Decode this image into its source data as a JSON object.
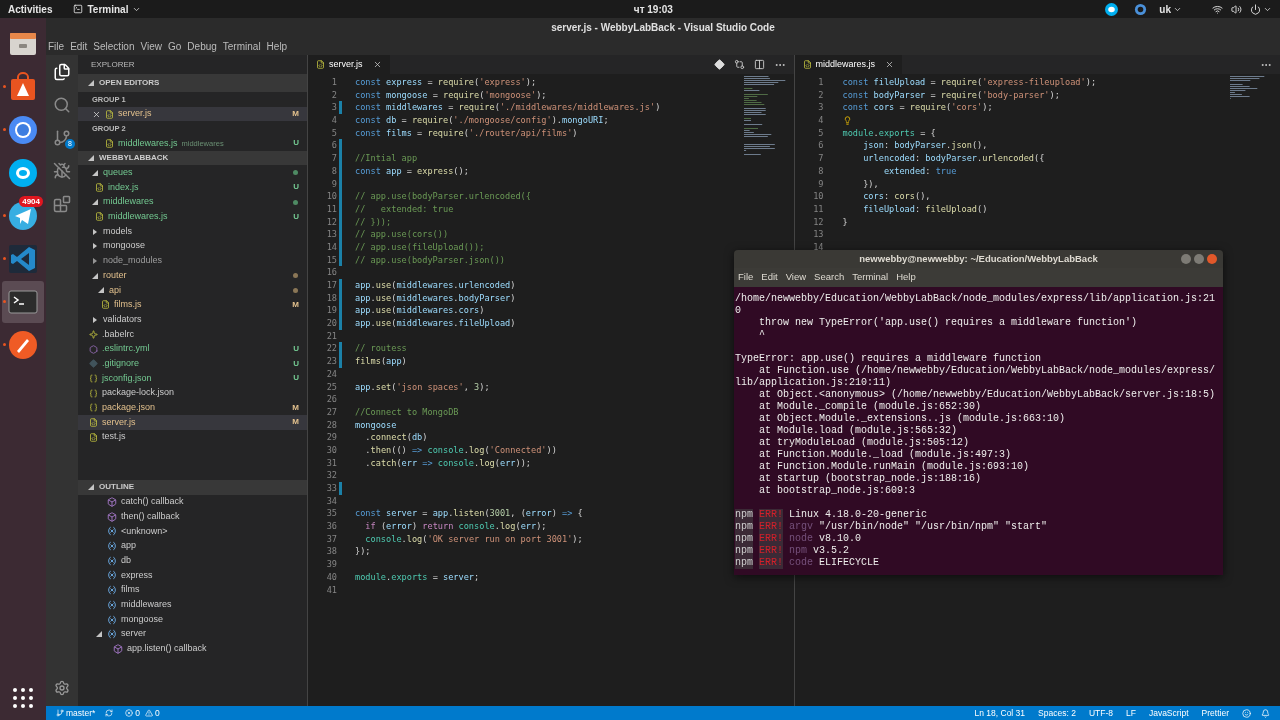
{
  "top_bar": {
    "activities": "Activities",
    "app_menu": "Terminal",
    "clock": "чт 19:03",
    "keyboard": "uk"
  },
  "dock": {
    "items": [
      {
        "kind": "files",
        "running": false,
        "selected": false
      },
      {
        "kind": "software",
        "running": true,
        "selected": false
      },
      {
        "kind": "browser",
        "running": true,
        "selected": false
      },
      {
        "kind": "skype",
        "running": false,
        "selected": false
      },
      {
        "kind": "telegram",
        "running": true,
        "selected": false,
        "badge": "4904"
      },
      {
        "kind": "vscode",
        "running": true,
        "selected": false
      },
      {
        "kind": "terminal",
        "running": true,
        "selected": true
      },
      {
        "kind": "postman",
        "running": true,
        "selected": false
      }
    ]
  },
  "vscode": {
    "title": "server.js - WebbyLabBack - Visual Studio Code",
    "menu": [
      "File",
      "Edit",
      "Selection",
      "View",
      "Go",
      "Debug",
      "Terminal",
      "Help"
    ],
    "activity_bar": [
      {
        "kind": "files",
        "selected": true
      },
      {
        "kind": "search",
        "selected": false
      },
      {
        "kind": "scm",
        "selected": false,
        "badge": "8"
      },
      {
        "kind": "debug",
        "selected": false
      },
      {
        "kind": "extensions",
        "selected": false
      }
    ],
    "sidebar": {
      "title": "EXPLORER",
      "open_editors": {
        "title": "OPEN EDITORS",
        "expanded": true,
        "groups": [
          {
            "title": "GROUP 1",
            "files": [
              {
                "name": "server.js",
                "kind": "js",
                "modified": true,
                "untracked": false,
                "badge": "M",
                "selected": true
              }
            ]
          },
          {
            "title": "GROUP 2",
            "files": [
              {
                "name": "middlewares.js",
                "description": "middlewares",
                "kind": "js",
                "modified": false,
                "untracked": true,
                "badge": "U",
                "selected": false
              }
            ]
          }
        ]
      },
      "project": {
        "title": "WEBBYLABBACK",
        "expanded": true,
        "tree": [
          {
            "kind": "folder",
            "name": "queues",
            "modified": false,
            "untracked": true,
            "ignored": false,
            "expanded": true,
            "selected": false,
            "children": [
              {
                "kind": "js",
                "name": "index.js",
                "modified": false,
                "untracked": true,
                "ignored": false,
                "badge": "U",
                "selected": false
              }
            ]
          },
          {
            "kind": "folder",
            "name": "middlewares",
            "modified": false,
            "untracked": true,
            "ignored": false,
            "expanded": true,
            "selected": false,
            "children": [
              {
                "kind": "js",
                "name": "middlewares.js",
                "modified": false,
                "untracked": true,
                "ignored": false,
                "badge": "U",
                "selected": false
              }
            ]
          },
          {
            "kind": "folder",
            "name": "models",
            "modified": false,
            "untracked": false,
            "ignored": false,
            "expanded": false,
            "selected": false
          },
          {
            "kind": "folder",
            "name": "mongoose",
            "modified": false,
            "untracked": false,
            "ignored": false,
            "expanded": false,
            "selected": false
          },
          {
            "kind": "folder",
            "name": "node_modules",
            "modified": false,
            "untracked": false,
            "ignored": true,
            "expanded": false,
            "selected": false
          },
          {
            "kind": "folder",
            "name": "router",
            "modified": true,
            "untracked": false,
            "ignored": false,
            "expanded": true,
            "selected": false,
            "children": [
              {
                "kind": "folder",
                "name": "api",
                "modified": true,
                "untracked": false,
                "ignored": false,
                "expanded": true,
                "selected": false,
                "children": [
                  {
                    "kind": "js",
                    "name": "films.js",
                    "modified": true,
                    "untracked": false,
                    "ignored": false,
                    "badge": "M",
                    "selected": false
                  }
                ]
              }
            ]
          },
          {
            "kind": "folder",
            "name": "validators",
            "modified": false,
            "untracked": false,
            "ignored": false,
            "expanded": false,
            "selected": false
          },
          {
            "kind": "babel",
            "name": ".babelrc",
            "modified": false,
            "untracked": false,
            "ignored": false,
            "selected": false
          },
          {
            "kind": "eslint",
            "name": ".eslintrc.yml",
            "modified": false,
            "untracked": true,
            "ignored": false,
            "badge": "U",
            "selected": false
          },
          {
            "kind": "git",
            "name": ".gitignore",
            "modified": false,
            "untracked": true,
            "ignored": false,
            "badge": "U",
            "selected": false
          },
          {
            "kind": "json",
            "name": "jsconfig.json",
            "modified": false,
            "untracked": true,
            "ignored": false,
            "badge": "U",
            "selected": false
          },
          {
            "kind": "json",
            "name": "package-lock.json",
            "modified": false,
            "untracked": false,
            "ignored": false,
            "selected": false
          },
          {
            "kind": "json",
            "name": "package.json",
            "modified": true,
            "untracked": false,
            "ignored": false,
            "badge": "M",
            "selected": false
          },
          {
            "kind": "js",
            "name": "server.js",
            "modified": true,
            "untracked": false,
            "ignored": false,
            "badge": "M",
            "selected": true
          },
          {
            "kind": "js",
            "name": "test.js",
            "modified": false,
            "untracked": false,
            "ignored": false,
            "selected": false
          }
        ]
      },
      "outline": {
        "title": "OUTLINE",
        "expanded": true,
        "items": [
          {
            "kind": "callback",
            "name": "catch() callback"
          },
          {
            "kind": "callback",
            "name": "then() callback"
          },
          {
            "kind": "variable",
            "name": "<unknown>"
          },
          {
            "kind": "variable",
            "name": "app"
          },
          {
            "kind": "variable",
            "name": "db"
          },
          {
            "kind": "variable",
            "name": "express"
          },
          {
            "kind": "variable",
            "name": "films"
          },
          {
            "kind": "variable",
            "name": "middlewares"
          },
          {
            "kind": "variable",
            "name": "mongoose"
          },
          {
            "kind": "variable",
            "name": "server",
            "expanded": true,
            "children": [
              {
                "kind": "callback",
                "name": "app.listen() callback"
              }
            ]
          }
        ]
      }
    },
    "editors": [
      {
        "tab": {
          "label": "server.js",
          "selected": true
        },
        "lines": [
          {
            "number": "1",
            "changed": false,
            "tokens": [
              {
                "kind": "kw",
                "text": "const "
              },
              {
                "kind": "var",
                "text": "express"
              },
              {
                "kind": "p",
                "text": " = "
              },
              {
                "kind": "fn",
                "text": "require"
              },
              {
                "kind": "p",
                "text": "("
              },
              {
                "kind": "str",
                "text": "'express'"
              },
              {
                "kind": "p",
                "text": ");"
              }
            ]
          },
          {
            "number": "2",
            "changed": false,
            "tokens": [
              {
                "kind": "kw",
                "text": "const "
              },
              {
                "kind": "var",
                "text": "mongoose"
              },
              {
                "kind": "p",
                "text": " = "
              },
              {
                "kind": "fn",
                "text": "require"
              },
              {
                "kind": "p",
                "text": "("
              },
              {
                "kind": "str",
                "text": "'mongoose'"
              },
              {
                "kind": "p",
                "text": ");"
              }
            ]
          },
          {
            "number": "3",
            "changed": true,
            "tokens": [
              {
                "kind": "kw",
                "text": "const "
              },
              {
                "kind": "var",
                "text": "middlewares"
              },
              {
                "kind": "p",
                "text": " = "
              },
              {
                "kind": "fn",
                "text": "require"
              },
              {
                "kind": "p",
                "text": "("
              },
              {
                "kind": "str",
                "text": "'./middlewares/middlewares.js'"
              },
              {
                "kind": "p",
                "text": ")"
              }
            ]
          },
          {
            "number": "4",
            "changed": false,
            "tokens": [
              {
                "kind": "kw",
                "text": "const "
              },
              {
                "kind": "var",
                "text": "db"
              },
              {
                "kind": "p",
                "text": " = "
              },
              {
                "kind": "fn",
                "text": "require"
              },
              {
                "kind": "p",
                "text": "("
              },
              {
                "kind": "str",
                "text": "'./mongoose/config'"
              },
              {
                "kind": "p",
                "text": ")."
              },
              {
                "kind": "var",
                "text": "mongoURI"
              },
              {
                "kind": "p",
                "text": ";"
              }
            ]
          },
          {
            "number": "5",
            "changed": false,
            "tokens": [
              {
                "kind": "kw",
                "text": "const "
              },
              {
                "kind": "var",
                "text": "films"
              },
              {
                "kind": "p",
                "text": " = "
              },
              {
                "kind": "fn",
                "text": "require"
              },
              {
                "kind": "p",
                "text": "("
              },
              {
                "kind": "str",
                "text": "'./router/api/films'"
              },
              {
                "kind": "p",
                "text": ")"
              }
            ]
          },
          {
            "number": "6",
            "changed": true
          },
          {
            "number": "7",
            "changed": true,
            "tokens": [
              {
                "kind": "com",
                "text": "//Intial app"
              }
            ]
          },
          {
            "number": "8",
            "changed": true,
            "tokens": [
              {
                "kind": "kw",
                "text": "const "
              },
              {
                "kind": "var",
                "text": "app"
              },
              {
                "kind": "p",
                "text": " = "
              },
              {
                "kind": "fn",
                "text": "express"
              },
              {
                "kind": "p",
                "text": "();"
              }
            ]
          },
          {
            "number": "9",
            "changed": true
          },
          {
            "number": "10",
            "changed": true,
            "tokens": [
              {
                "kind": "com",
                "text": "// app.use(bodyParser.urlencoded({"
              }
            ]
          },
          {
            "number": "11",
            "changed": true,
            "tokens": [
              {
                "kind": "com",
                "text": "//   extended: true"
              }
            ]
          },
          {
            "number": "12",
            "changed": true,
            "tokens": [
              {
                "kind": "com",
                "text": "// }));"
              }
            ]
          },
          {
            "number": "13",
            "changed": true,
            "tokens": [
              {
                "kind": "com",
                "text": "// app.use(cors())"
              }
            ]
          },
          {
            "number": "14",
            "changed": true,
            "tokens": [
              {
                "kind": "com",
                "text": "// app.use(fileUpload());"
              }
            ]
          },
          {
            "number": "15",
            "changed": true,
            "tokens": [
              {
                "kind": "com",
                "text": "// app.use(bodyParser.json())"
              }
            ]
          },
          {
            "number": "16",
            "changed": false
          },
          {
            "number": "17",
            "changed": true,
            "tokens": [
              {
                "kind": "var",
                "text": "app"
              },
              {
                "kind": "p",
                "text": "."
              },
              {
                "kind": "fn",
                "text": "use"
              },
              {
                "kind": "p",
                "text": "("
              },
              {
                "kind": "var",
                "text": "middlewares"
              },
              {
                "kind": "p",
                "text": "."
              },
              {
                "kind": "var",
                "text": "urlencoded"
              },
              {
                "kind": "p",
                "text": ")"
              }
            ]
          },
          {
            "number": "18",
            "changed": true,
            "tokens": [
              {
                "kind": "var",
                "text": "app"
              },
              {
                "kind": "p",
                "text": "."
              },
              {
                "kind": "fn",
                "text": "use"
              },
              {
                "kind": "p",
                "text": "("
              },
              {
                "kind": "var",
                "text": "middlewares"
              },
              {
                "kind": "p",
                "text": "."
              },
              {
                "kind": "var",
                "text": "bodyParser"
              },
              {
                "kind": "p",
                "text": ")"
              }
            ]
          },
          {
            "number": "19",
            "changed": true,
            "tokens": [
              {
                "kind": "var",
                "text": "app"
              },
              {
                "kind": "p",
                "text": "."
              },
              {
                "kind": "fn",
                "text": "use"
              },
              {
                "kind": "p",
                "text": "("
              },
              {
                "kind": "var",
                "text": "middlewares"
              },
              {
                "kind": "p",
                "text": "."
              },
              {
                "kind": "var",
                "text": "cors"
              },
              {
                "kind": "p",
                "text": ")"
              }
            ]
          },
          {
            "number": "20",
            "changed": true,
            "tokens": [
              {
                "kind": "var",
                "text": "app"
              },
              {
                "kind": "p",
                "text": "."
              },
              {
                "kind": "fn",
                "text": "use"
              },
              {
                "kind": "p",
                "text": "("
              },
              {
                "kind": "var",
                "text": "middlewares"
              },
              {
                "kind": "p",
                "text": "."
              },
              {
                "kind": "var",
                "text": "fileUpload"
              },
              {
                "kind": "p",
                "text": ")"
              }
            ]
          },
          {
            "number": "21",
            "changed": false
          },
          {
            "number": "22",
            "changed": true,
            "tokens": [
              {
                "kind": "com",
                "text": "// routess"
              }
            ]
          },
          {
            "number": "23",
            "changed": true,
            "tokens": [
              {
                "kind": "fn",
                "text": "films"
              },
              {
                "kind": "p",
                "text": "("
              },
              {
                "kind": "var",
                "text": "app"
              },
              {
                "kind": "p",
                "text": ")"
              }
            ]
          },
          {
            "number": "24",
            "changed": false
          },
          {
            "number": "25",
            "changed": false,
            "tokens": [
              {
                "kind": "var",
                "text": "app"
              },
              {
                "kind": "p",
                "text": "."
              },
              {
                "kind": "fn",
                "text": "set"
              },
              {
                "kind": "p",
                "text": "("
              },
              {
                "kind": "str",
                "text": "'json spaces'"
              },
              {
                "kind": "p",
                "text": ", "
              },
              {
                "kind": "num",
                "text": "3"
              },
              {
                "kind": "p",
                "text": ");"
              }
            ]
          },
          {
            "number": "26",
            "changed": false
          },
          {
            "number": "27",
            "changed": false,
            "tokens": [
              {
                "kind": "com",
                "text": "//Connect to MongoDB"
              }
            ]
          },
          {
            "number": "28",
            "changed": false,
            "tokens": [
              {
                "kind": "var",
                "text": "mongoose"
              }
            ]
          },
          {
            "number": "29",
            "changed": false,
            "tokens": [
              {
                "kind": "p",
                "text": "  ."
              },
              {
                "kind": "fn",
                "text": "connect"
              },
              {
                "kind": "p",
                "text": "("
              },
              {
                "kind": "var",
                "text": "db"
              },
              {
                "kind": "p",
                "text": ")"
              }
            ]
          },
          {
            "number": "30",
            "changed": false,
            "tokens": [
              {
                "kind": "p",
                "text": "  ."
              },
              {
                "kind": "fn",
                "text": "then"
              },
              {
                "kind": "p",
                "text": "(() "
              },
              {
                "kind": "kw",
                "text": "=> "
              },
              {
                "kind": "cls",
                "text": "console"
              },
              {
                "kind": "p",
                "text": "."
              },
              {
                "kind": "fn",
                "text": "log"
              },
              {
                "kind": "p",
                "text": "("
              },
              {
                "kind": "str",
                "text": "'Connected'"
              },
              {
                "kind": "p",
                "text": "))"
              }
            ]
          },
          {
            "number": "31",
            "changed": false,
            "tokens": [
              {
                "kind": "p",
                "text": "  ."
              },
              {
                "kind": "fn",
                "text": "catch"
              },
              {
                "kind": "p",
                "text": "("
              },
              {
                "kind": "var",
                "text": "err "
              },
              {
                "kind": "kw",
                "text": "=> "
              },
              {
                "kind": "cls",
                "text": "console"
              },
              {
                "kind": "p",
                "text": "."
              },
              {
                "kind": "fn",
                "text": "log"
              },
              {
                "kind": "p",
                "text": "("
              },
              {
                "kind": "var",
                "text": "err"
              },
              {
                "kind": "p",
                "text": "));"
              }
            ]
          },
          {
            "number": "32",
            "changed": false
          },
          {
            "number": "33",
            "changed": true
          },
          {
            "number": "34",
            "changed": false
          },
          {
            "number": "35",
            "changed": false,
            "tokens": [
              {
                "kind": "kw",
                "text": "const "
              },
              {
                "kind": "var",
                "text": "server"
              },
              {
                "kind": "p",
                "text": " = "
              },
              {
                "kind": "var",
                "text": "app"
              },
              {
                "kind": "p",
                "text": "."
              },
              {
                "kind": "fn",
                "text": "listen"
              },
              {
                "kind": "p",
                "text": "("
              },
              {
                "kind": "num",
                "text": "3001"
              },
              {
                "kind": "p",
                "text": ", ("
              },
              {
                "kind": "var",
                "text": "error"
              },
              {
                "kind": "p",
                "text": ") "
              },
              {
                "kind": "kw",
                "text": "=>"
              },
              {
                "kind": "p",
                "text": " {"
              }
            ]
          },
          {
            "number": "36",
            "changed": false,
            "tokens": [
              {
                "kind": "ctl",
                "text": "  if"
              },
              {
                "kind": "p",
                "text": " ("
              },
              {
                "kind": "var",
                "text": "error"
              },
              {
                "kind": "p",
                "text": ") "
              },
              {
                "kind": "ctl",
                "text": "return "
              },
              {
                "kind": "cls",
                "text": "console"
              },
              {
                "kind": "p",
                "text": "."
              },
              {
                "kind": "fn",
                "text": "log"
              },
              {
                "kind": "p",
                "text": "("
              },
              {
                "kind": "var",
                "text": "err"
              },
              {
                "kind": "p",
                "text": ");"
              }
            ]
          },
          {
            "number": "37",
            "changed": false,
            "tokens": [
              {
                "kind": "cls",
                "text": "  console"
              },
              {
                "kind": "p",
                "text": "."
              },
              {
                "kind": "fn",
                "text": "log"
              },
              {
                "kind": "p",
                "text": "("
              },
              {
                "kind": "str",
                "text": "'OK server run on port 3001'"
              },
              {
                "kind": "p",
                "text": ");"
              }
            ]
          },
          {
            "number": "38",
            "changed": false,
            "tokens": [
              {
                "kind": "p",
                "text": "});"
              }
            ]
          },
          {
            "number": "39",
            "changed": false
          },
          {
            "number": "40",
            "changed": false,
            "tokens": [
              {
                "kind": "cls",
                "text": "module"
              },
              {
                "kind": "p",
                "text": "."
              },
              {
                "kind": "cls",
                "text": "exports"
              },
              {
                "kind": "p",
                "text": " = "
              },
              {
                "kind": "var",
                "text": "server"
              },
              {
                "kind": "p",
                "text": ";"
              }
            ]
          },
          {
            "number": "41",
            "changed": false
          }
        ]
      },
      {
        "tab": {
          "label": "middlewares.js",
          "selected": true
        },
        "lines": [
          {
            "number": "1",
            "tokens": [
              {
                "kind": "kw",
                "text": "const "
              },
              {
                "kind": "var",
                "text": "fileUpload"
              },
              {
                "kind": "p",
                "text": " = "
              },
              {
                "kind": "fn",
                "text": "require"
              },
              {
                "kind": "p",
                "text": "("
              },
              {
                "kind": "str",
                "text": "'express-fileupload'"
              },
              {
                "kind": "p",
                "text": ");"
              }
            ]
          },
          {
            "number": "2",
            "tokens": [
              {
                "kind": "kw",
                "text": "const "
              },
              {
                "kind": "var",
                "text": "bodyParser"
              },
              {
                "kind": "p",
                "text": " = "
              },
              {
                "kind": "fn",
                "text": "require"
              },
              {
                "kind": "p",
                "text": "("
              },
              {
                "kind": "str",
                "text": "'body-parser'"
              },
              {
                "kind": "p",
                "text": ");"
              }
            ]
          },
          {
            "number": "3",
            "tokens": [
              {
                "kind": "kw",
                "text": "const "
              },
              {
                "kind": "var",
                "text": "cors"
              },
              {
                "kind": "p",
                "text": " = "
              },
              {
                "kind": "fn",
                "text": "require"
              },
              {
                "kind": "p",
                "text": "("
              },
              {
                "kind": "str",
                "text": "'cors'"
              },
              {
                "kind": "p",
                "text": ");"
              }
            ]
          },
          {
            "number": "4",
            "hint": true
          },
          {
            "number": "5",
            "tokens": [
              {
                "kind": "cls",
                "text": "module"
              },
              {
                "kind": "p",
                "text": "."
              },
              {
                "kind": "cls",
                "text": "exports"
              },
              {
                "kind": "p",
                "text": " = {"
              }
            ]
          },
          {
            "number": "6",
            "tokens": [
              {
                "kind": "var",
                "text": "    json"
              },
              {
                "kind": "p",
                "text": ": "
              },
              {
                "kind": "var",
                "text": "bodyParser"
              },
              {
                "kind": "p",
                "text": "."
              },
              {
                "kind": "fn",
                "text": "json"
              },
              {
                "kind": "p",
                "text": "(),"
              }
            ]
          },
          {
            "number": "7",
            "tokens": [
              {
                "kind": "var",
                "text": "    urlencoded"
              },
              {
                "kind": "p",
                "text": ": "
              },
              {
                "kind": "var",
                "text": "bodyParser"
              },
              {
                "kind": "p",
                "text": "."
              },
              {
                "kind": "fn",
                "text": "urlencoded"
              },
              {
                "kind": "p",
                "text": "({"
              }
            ]
          },
          {
            "number": "8",
            "tokens": [
              {
                "kind": "var",
                "text": "        extended"
              },
              {
                "kind": "p",
                "text": ": "
              },
              {
                "kind": "kw",
                "text": "true"
              }
            ]
          },
          {
            "number": "9",
            "tokens": [
              {
                "kind": "p",
                "text": "    }),"
              }
            ]
          },
          {
            "number": "10",
            "tokens": [
              {
                "kind": "var",
                "text": "    cors"
              },
              {
                "kind": "p",
                "text": ": "
              },
              {
                "kind": "fn",
                "text": "cors"
              },
              {
                "kind": "p",
                "text": "(),"
              }
            ]
          },
          {
            "number": "11",
            "tokens": [
              {
                "kind": "var",
                "text": "    fileUpload"
              },
              {
                "kind": "p",
                "text": ": "
              },
              {
                "kind": "fn",
                "text": "fileUpload"
              },
              {
                "kind": "p",
                "text": "()"
              }
            ]
          },
          {
            "number": "12",
            "tokens": [
              {
                "kind": "p",
                "text": "}"
              }
            ]
          },
          {
            "number": "13"
          },
          {
            "number": "14"
          }
        ]
      }
    ],
    "status_bar": {
      "branch": "master*",
      "errors": "0",
      "warnings": "0",
      "items": [
        "Ln 18, Col 31",
        "Spaces: 2",
        "UTF-8",
        "LF",
        "JavaScript",
        "Prettier"
      ]
    }
  },
  "terminal": {
    "title": "newwebby@newwebby: ~/Education/WebbyLabBack",
    "menu": [
      "File",
      "Edit",
      "View",
      "Search",
      "Terminal",
      "Help"
    ],
    "lines": [
      {
        "kind": "text",
        "text": "/home/newwebby/Education/WebbyLabBack/node_modules/express/lib/application.js:21"
      },
      {
        "kind": "text",
        "text": "0"
      },
      {
        "kind": "text",
        "text": "    throw new TypeError('app.use() requires a middleware function')"
      },
      {
        "kind": "text",
        "text": "    ^"
      },
      {
        "kind": "blank"
      },
      {
        "kind": "text",
        "text": "TypeError: app.use() requires a middleware function"
      },
      {
        "kind": "text",
        "text": "    at Function.use (/home/newwebby/Education/WebbyLabBack/node_modules/express/"
      },
      {
        "kind": "text",
        "text": "lib/application.js:210:11)"
      },
      {
        "kind": "text",
        "text": "    at Object.<anonymous> (/home/newwebby/Education/WebbyLabBack/server.js:18:5)"
      },
      {
        "kind": "text",
        "text": "    at Module._compile (module.js:652:30)"
      },
      {
        "kind": "text",
        "text": "    at Object.Module._extensions..js (module.js:663:10)"
      },
      {
        "kind": "text",
        "text": "    at Module.load (module.js:565:32)"
      },
      {
        "kind": "text",
        "text": "    at tryModuleLoad (module.js:505:12)"
      },
      {
        "kind": "text",
        "text": "    at Function.Module._load (module.js:497:3)"
      },
      {
        "kind": "text",
        "text": "    at Function.Module.runMain (module.js:693:10)"
      },
      {
        "kind": "text",
        "text": "    at startup (bootstrap_node.js:188:16)"
      },
      {
        "kind": "text",
        "text": "    at bootstrap_node.js:609:3"
      },
      {
        "kind": "blank"
      },
      {
        "kind": "npm",
        "prefix": "npm",
        "tag": "ERR!",
        "value": "Linux 4.18.0-20-generic"
      },
      {
        "kind": "npm",
        "prefix": "npm",
        "tag": "ERR!",
        "key": "argv",
        "value": "\"/usr/bin/node\" \"/usr/bin/npm\" \"start\""
      },
      {
        "kind": "npm",
        "prefix": "npm",
        "tag": "ERR!",
        "key": "node",
        "value": "v8.10.0"
      },
      {
        "kind": "npm",
        "prefix": "npm",
        "tag": "ERR!",
        "key": "npm",
        "value": "v3.5.2"
      },
      {
        "kind": "npm",
        "prefix": "npm",
        "tag": "ERR!",
        "key": "code",
        "value": "ELIFECYCLE"
      }
    ]
  }
}
